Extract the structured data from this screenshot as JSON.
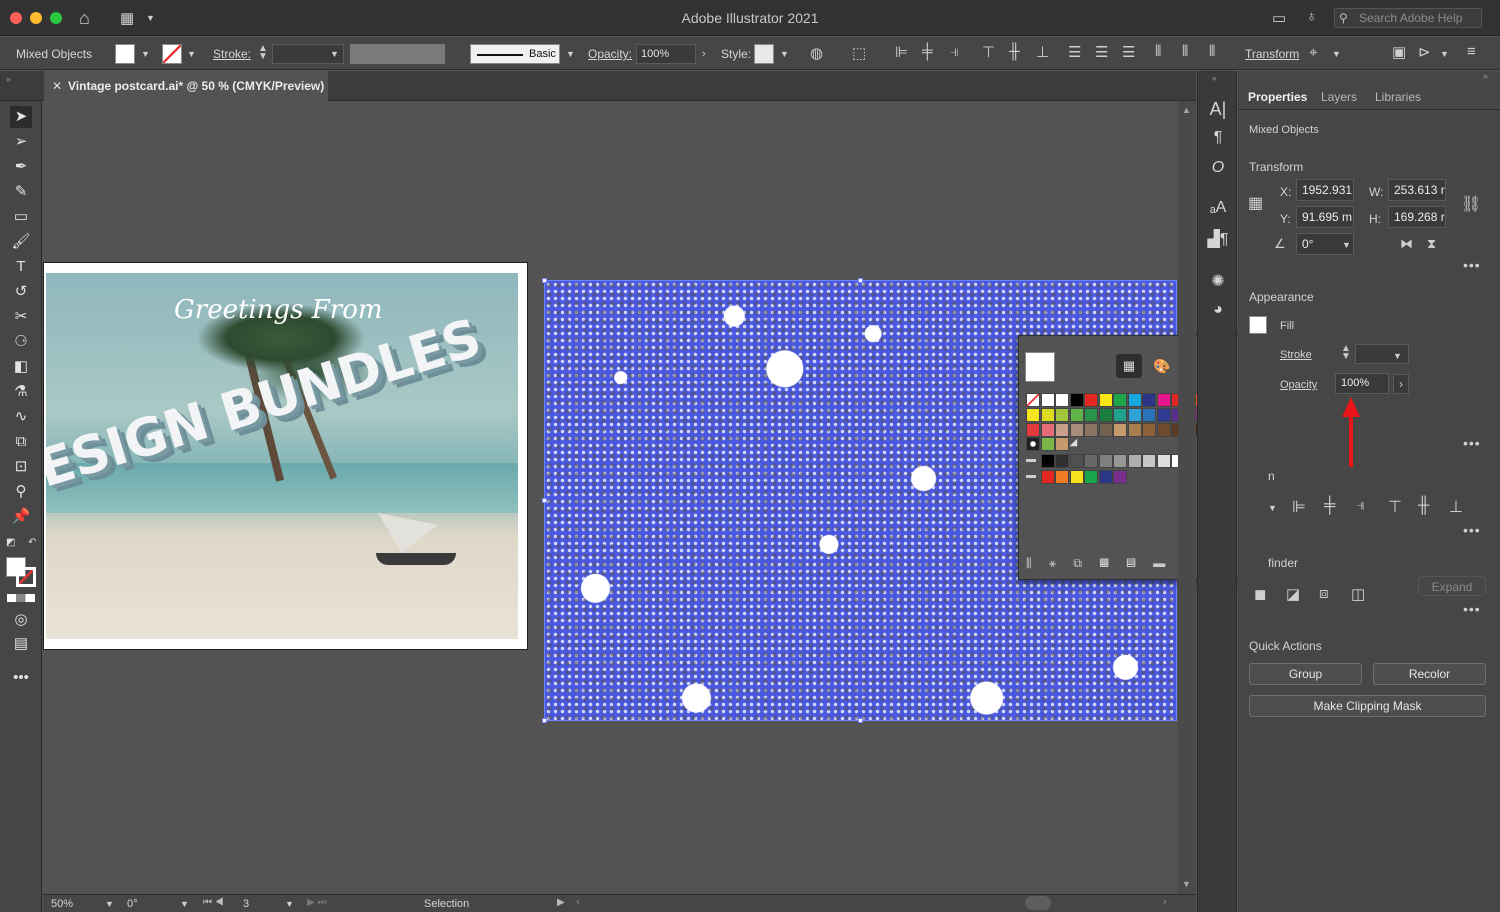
{
  "window": {
    "title": "Adobe Illustrator 2021",
    "search_placeholder": "Search Adobe Help"
  },
  "control_bar": {
    "selection_label": "Mixed Objects",
    "stroke_label": "Stroke:",
    "brush_label": "Basic",
    "opacity_label": "Opacity:",
    "opacity_value": "100%",
    "style_label": "Style:",
    "transform_label": "Transform"
  },
  "document_tab": {
    "title": "Vintage postcard.ai* @ 50 % (CMYK/Preview)"
  },
  "artwork": {
    "greeting": "Greetings From",
    "headline": "ESIGN BUNDLES"
  },
  "status_bar": {
    "zoom": "50%",
    "rotation": "0°",
    "artboard": "3",
    "tool": "Selection"
  },
  "properties": {
    "tabs": [
      "Properties",
      "Layers",
      "Libraries"
    ],
    "selection": "Mixed Objects",
    "transform": {
      "heading": "Transform",
      "x_label": "X:",
      "x": "1952.931",
      "y_label": "Y:",
      "y": "91.695 m",
      "w_label": "W:",
      "w": "253.613 r",
      "h_label": "H:",
      "h": "169.268 r",
      "angle": "0°"
    },
    "appearance": {
      "heading": "Appearance",
      "fill": "Fill",
      "stroke": "Stroke",
      "opacity_label": "Opacity",
      "opacity": "100%"
    },
    "align_heading_partial": "n",
    "pathfinder_partial": "finder",
    "expand": "Expand",
    "quick_actions": {
      "heading": "Quick Actions",
      "group": "Group",
      "recolor": "Recolor",
      "clipping_mask": "Make Clipping Mask"
    }
  },
  "colors": {
    "accent_arrow": "#e8161b",
    "selection_blue": "#4a58e0"
  }
}
